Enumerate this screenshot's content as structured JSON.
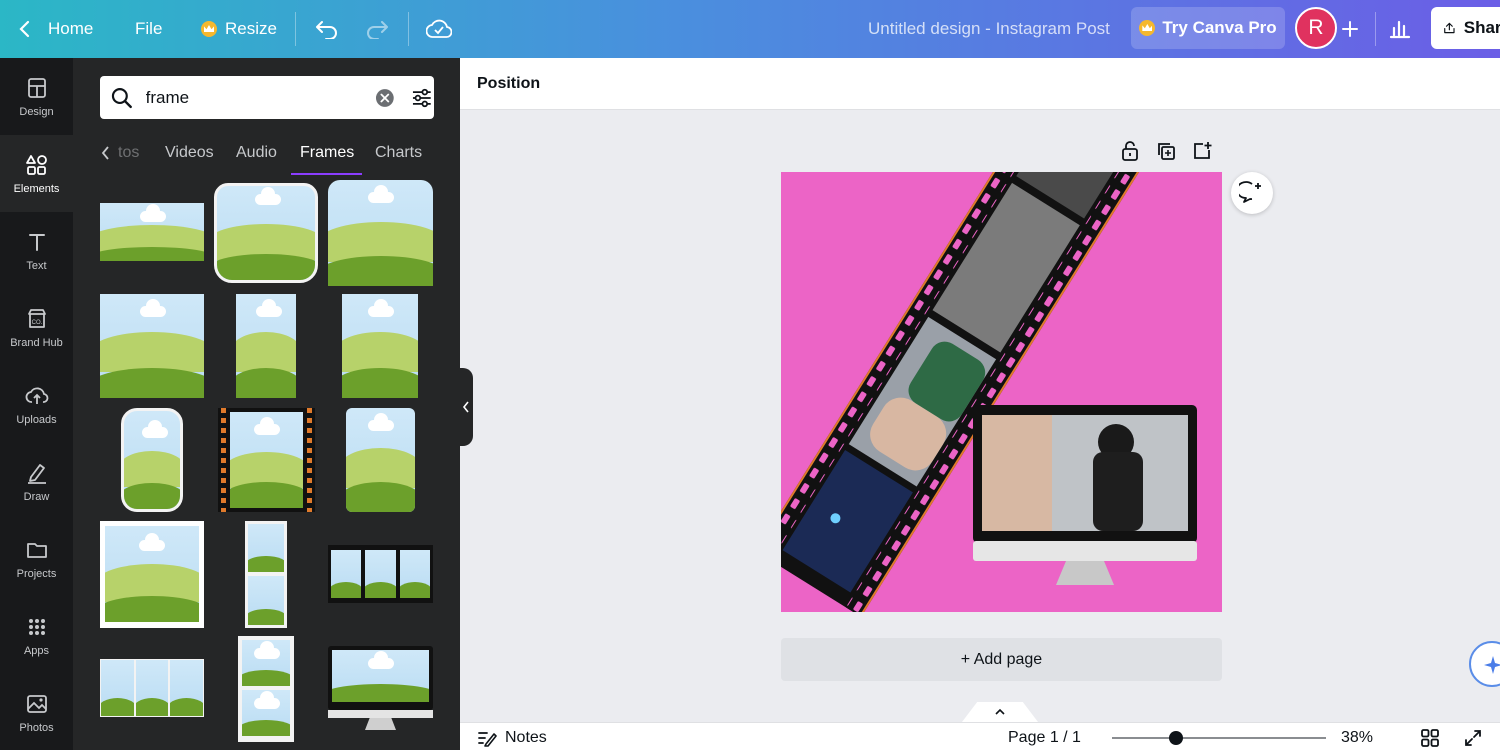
{
  "topbar": {
    "home_label": "Home",
    "file_label": "File",
    "resize_label": "Resize",
    "doc_title": "Untitled design - Instagram Post",
    "try_pro_label": "Try Canva Pro",
    "avatar_initial": "R",
    "share_label": "Share"
  },
  "rail": {
    "items": [
      {
        "label": "Design",
        "icon": "layout-icon"
      },
      {
        "label": "Elements",
        "icon": "shapes-icon"
      },
      {
        "label": "Text",
        "icon": "text-icon"
      },
      {
        "label": "Brand Hub",
        "icon": "brand-icon"
      },
      {
        "label": "Uploads",
        "icon": "cloud-upload-icon"
      },
      {
        "label": "Draw",
        "icon": "pen-icon"
      },
      {
        "label": "Projects",
        "icon": "folder-icon"
      },
      {
        "label": "Apps",
        "icon": "grid-icon"
      },
      {
        "label": "Photos",
        "icon": "image-icon"
      }
    ]
  },
  "panel": {
    "search_value": "frame",
    "tabs": [
      "tos",
      "Videos",
      "Audio",
      "Frames",
      "Charts"
    ],
    "active_tab": "Frames"
  },
  "editor": {
    "context_label": "Position",
    "add_page_label": "+ Add page"
  },
  "bottombar": {
    "notes_label": "Notes",
    "page_label": "Page 1 / 1",
    "zoom_label": "38%",
    "zoom_fraction": 0.3
  },
  "colors": {
    "canvas_bg": "#ec64c6",
    "brand_purple": "#8b3dff",
    "avatar": "#e0325f"
  }
}
